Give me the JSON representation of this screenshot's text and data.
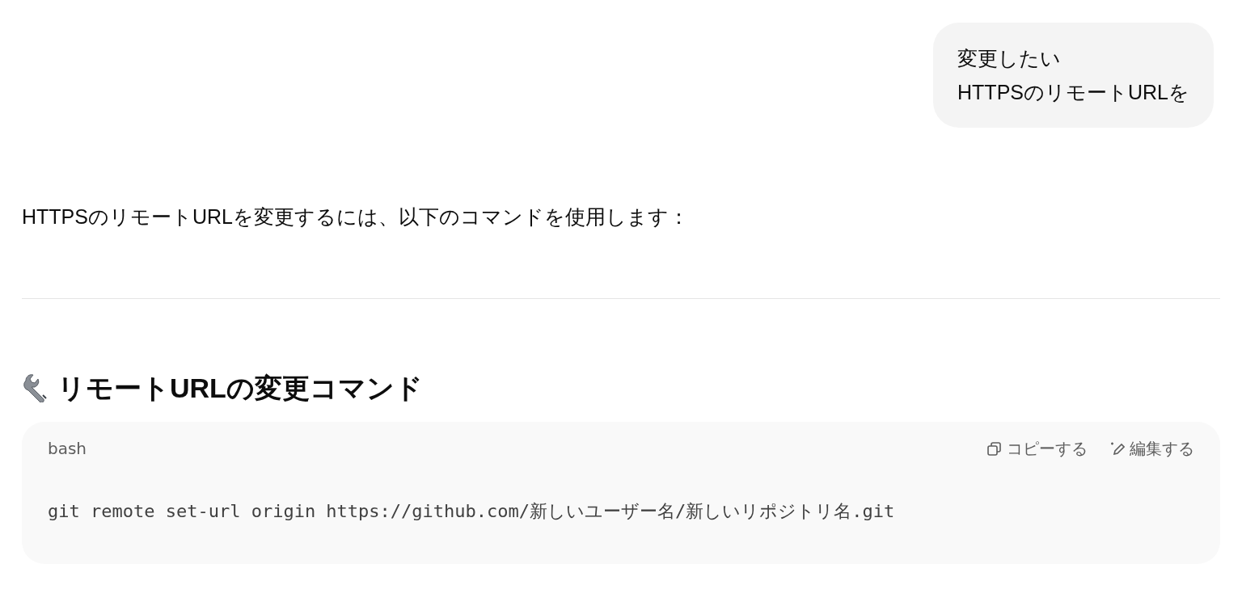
{
  "user_message": {
    "lines": [
      "変更したい",
      "HTTPSのリモートURLを"
    ]
  },
  "reply": {
    "paragraph": "HTTPSのリモートURLを変更するには、以下のコマンドを使用します：",
    "heading": "リモートURLの変更コマンド",
    "code_block": {
      "language": "bash",
      "actions": [
        {
          "kind": "copy",
          "label": "コピーする"
        },
        {
          "kind": "edit",
          "label": "編集する"
        }
      ],
      "code": "git remote set-url origin https://github.com/新しいユーザー名/新しいリポジトリ名.git"
    }
  }
}
